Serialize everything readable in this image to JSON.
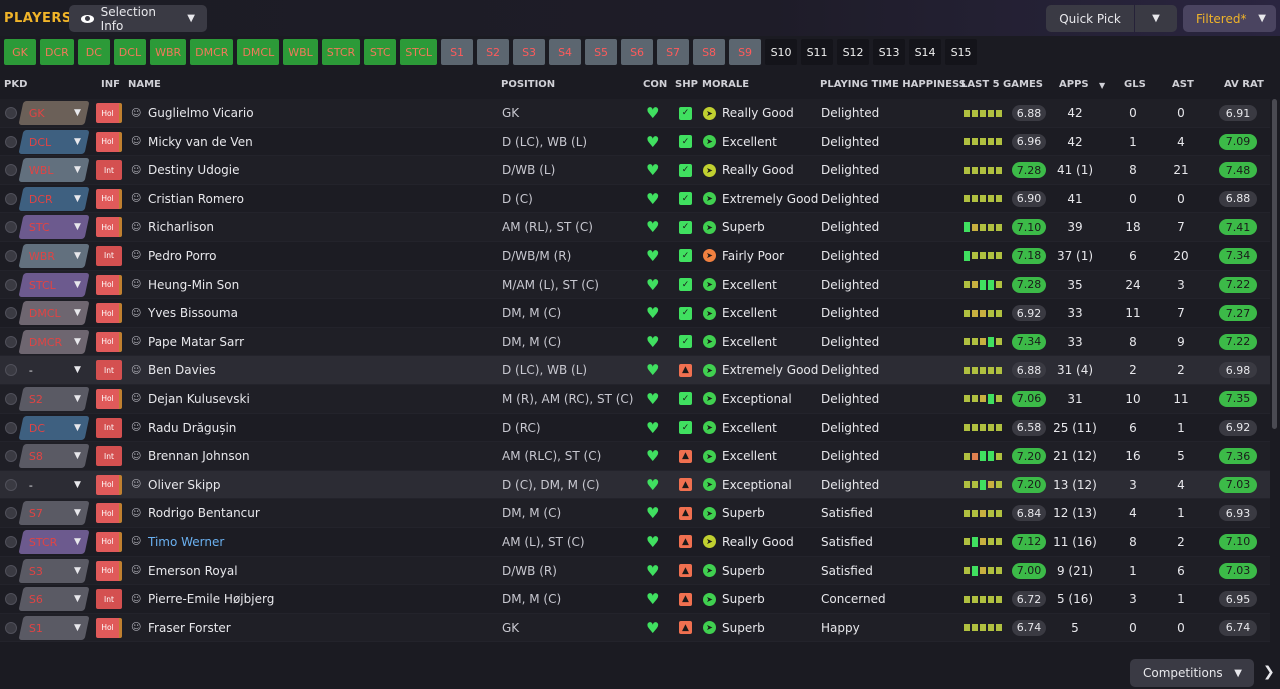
{
  "header": {
    "title": "PLAYERS",
    "selection_info": "Selection Info",
    "quick_pick": "Quick Pick",
    "filtered": "Filtered*"
  },
  "positions": [
    {
      "label": "GK",
      "state": "filled"
    },
    {
      "label": "DCR",
      "state": "filled"
    },
    {
      "label": "DC",
      "state": "filled"
    },
    {
      "label": "DCL",
      "state": "filled"
    },
    {
      "label": "WBR",
      "state": "filled"
    },
    {
      "label": "DMCR",
      "state": "filled"
    },
    {
      "label": "DMCL",
      "state": "filled"
    },
    {
      "label": "WBL",
      "state": "filled"
    },
    {
      "label": "STCR",
      "state": "filled"
    },
    {
      "label": "STC",
      "state": "filled"
    },
    {
      "label": "STCL",
      "state": "filled"
    },
    {
      "label": "S1",
      "state": "grey"
    },
    {
      "label": "S2",
      "state": "grey"
    },
    {
      "label": "S3",
      "state": "grey"
    },
    {
      "label": "S4",
      "state": "grey"
    },
    {
      "label": "S5",
      "state": "grey"
    },
    {
      "label": "S6",
      "state": "grey"
    },
    {
      "label": "S7",
      "state": "grey"
    },
    {
      "label": "S8",
      "state": "grey"
    },
    {
      "label": "S9",
      "state": "grey"
    },
    {
      "label": "S10",
      "state": "empty"
    },
    {
      "label": "S11",
      "state": "empty"
    },
    {
      "label": "S12",
      "state": "empty"
    },
    {
      "label": "S13",
      "state": "empty"
    },
    {
      "label": "S14",
      "state": "empty"
    },
    {
      "label": "S15",
      "state": "empty"
    }
  ],
  "columns": {
    "pkd": "PKD",
    "inf": "INF",
    "name": "NAME",
    "position": "POSITION",
    "con": "CON",
    "shp": "SHP",
    "morale": "MORALE",
    "pth": "PLAYING TIME HAPPINESS",
    "last5": "LAST 5 GAMES",
    "apps": "APPS",
    "gls": "GLS",
    "ast": "AST",
    "avrat": "AV RAT"
  },
  "players": [
    {
      "pkd": "GK",
      "pkd_style": "gk",
      "inf": "Hol",
      "name": "Guglielmo Vicario",
      "position": "GK",
      "shp": "g",
      "morale": "Really Good",
      "morale_color": "yellow",
      "pth": "Delighted",
      "bars": [
        "gr",
        "gr",
        "gr",
        "gr",
        "gr"
      ],
      "last5": "6.88",
      "last5_good": false,
      "apps": "42",
      "gls": "0",
      "ast": "0",
      "avrat": "6.91",
      "avrat_good": false
    },
    {
      "pkd": "DCL",
      "pkd_style": "def",
      "inf": "Hol",
      "name": "Micky van de Ven",
      "position": "D (LC), WB (L)",
      "shp": "g",
      "morale": "Excellent",
      "morale_color": "green",
      "pth": "Delighted",
      "bars": [
        "gr",
        "gr",
        "gr",
        "gr",
        "gr"
      ],
      "last5": "6.96",
      "last5_good": false,
      "apps": "42",
      "gls": "1",
      "ast": "4",
      "avrat": "7.09",
      "avrat_good": true
    },
    {
      "pkd": "WBL",
      "pkd_style": "wb",
      "inf": "Int",
      "name": "Destiny Udogie",
      "position": "D/WB (L)",
      "shp": "g",
      "morale": "Really Good",
      "morale_color": "yellow",
      "pth": "Delighted",
      "bars": [
        "gr",
        "gr",
        "gr",
        "gr",
        "gr"
      ],
      "last5": "7.28",
      "last5_good": true,
      "apps": "41 (1)",
      "gls": "8",
      "ast": "21",
      "avrat": "7.48",
      "avrat_good": true
    },
    {
      "pkd": "DCR",
      "pkd_style": "def",
      "inf": "Hol",
      "name": "Cristian Romero",
      "position": "D (C)",
      "shp": "g",
      "morale": "Extremely Good",
      "morale_color": "green",
      "pth": "Delighted",
      "bars": [
        "gr",
        "gr",
        "gr",
        "gr",
        "gr"
      ],
      "last5": "6.90",
      "last5_good": false,
      "apps": "41",
      "gls": "0",
      "ast": "0",
      "avrat": "6.88",
      "avrat_good": false
    },
    {
      "pkd": "STC",
      "pkd_style": "att",
      "inf": "Hol",
      "name": "Richarlison",
      "position": "AM (RL), ST (C)",
      "shp": "g",
      "morale": "Superb",
      "morale_color": "green",
      "pth": "Delighted",
      "bars": [
        "g",
        "y",
        "gr",
        "gr",
        "gr"
      ],
      "last5": "7.10",
      "last5_good": true,
      "apps": "39",
      "gls": "18",
      "ast": "7",
      "avrat": "7.41",
      "avrat_good": true
    },
    {
      "pkd": "WBR",
      "pkd_style": "wb",
      "inf": "Int",
      "name": "Pedro Porro",
      "position": "D/WB/M (R)",
      "shp": "g",
      "morale": "Fairly Poor",
      "morale_color": "orange",
      "pth": "Delighted",
      "bars": [
        "g",
        "gr",
        "gr",
        "gr",
        "gr"
      ],
      "last5": "7.18",
      "last5_good": true,
      "apps": "37 (1)",
      "gls": "6",
      "ast": "20",
      "avrat": "7.34",
      "avrat_good": true
    },
    {
      "pkd": "STCL",
      "pkd_style": "att",
      "inf": "Hol",
      "name": "Heung-Min Son",
      "position": "M/AM (L), ST (C)",
      "shp": "g",
      "morale": "Excellent",
      "morale_color": "green",
      "pth": "Delighted",
      "bars": [
        "gr",
        "y",
        "g",
        "g",
        "gr"
      ],
      "last5": "7.28",
      "last5_good": true,
      "apps": "35",
      "gls": "24",
      "ast": "3",
      "avrat": "7.22",
      "avrat_good": true
    },
    {
      "pkd": "DMCL",
      "pkd_style": "mid",
      "inf": "Hol",
      "name": "Yves Bissouma",
      "position": "DM, M (C)",
      "shp": "g",
      "morale": "Excellent",
      "morale_color": "green",
      "pth": "Delighted",
      "bars": [
        "gr",
        "y",
        "y",
        "gr",
        "gr"
      ],
      "last5": "6.92",
      "last5_good": false,
      "apps": "33",
      "gls": "11",
      "ast": "7",
      "avrat": "7.27",
      "avrat_good": true
    },
    {
      "pkd": "DMCR",
      "pkd_style": "mid",
      "inf": "Hol",
      "name": "Pape Matar Sarr",
      "position": "DM, M (C)",
      "shp": "g",
      "morale": "Excellent",
      "morale_color": "green",
      "pth": "Delighted",
      "bars": [
        "gr",
        "gr",
        "y",
        "g",
        "gr"
      ],
      "last5": "7.34",
      "last5_good": true,
      "apps": "33",
      "gls": "8",
      "ast": "9",
      "avrat": "7.22",
      "avrat_good": true
    },
    {
      "pkd": "-",
      "pkd_style": "none",
      "inf": "Int",
      "name": "Ben Davies",
      "position": "D (LC), WB (L)",
      "shp": "o",
      "morale": "Extremely Good",
      "morale_color": "green",
      "pth": "Delighted",
      "bars": [
        "gr",
        "gr",
        "gr",
        "gr",
        "gr"
      ],
      "last5": "6.88",
      "last5_good": false,
      "apps": "31 (4)",
      "gls": "2",
      "ast": "2",
      "avrat": "6.98",
      "avrat_good": false
    },
    {
      "pkd": "S2",
      "pkd_style": "sub",
      "inf": "Hol",
      "name": "Dejan Kulusevski",
      "position": "M (R), AM (RC), ST (C)",
      "shp": "g",
      "morale": "Exceptional",
      "morale_color": "green",
      "pth": "Delighted",
      "bars": [
        "gr",
        "gr",
        "y",
        "g",
        "gr"
      ],
      "last5": "7.06",
      "last5_good": true,
      "apps": "31",
      "gls": "10",
      "ast": "11",
      "avrat": "7.35",
      "avrat_good": true
    },
    {
      "pkd": "DC",
      "pkd_style": "def",
      "inf": "Int",
      "name": "Radu Drăgușin",
      "position": "D (RC)",
      "shp": "g",
      "morale": "Excellent",
      "morale_color": "green",
      "pth": "Delighted",
      "bars": [
        "gr",
        "gr",
        "gr",
        "gr",
        "gr"
      ],
      "last5": "6.58",
      "last5_good": false,
      "apps": "25 (11)",
      "gls": "6",
      "ast": "1",
      "avrat": "6.92",
      "avrat_good": false
    },
    {
      "pkd": "S8",
      "pkd_style": "sub",
      "inf": "Int",
      "name": "Brennan Johnson",
      "position": "AM (RLC), ST (C)",
      "shp": "o",
      "morale": "Excellent",
      "morale_color": "green",
      "pth": "Delighted",
      "bars": [
        "gr",
        "o",
        "g",
        "g",
        "gr"
      ],
      "last5": "7.20",
      "last5_good": true,
      "apps": "21 (12)",
      "gls": "16",
      "ast": "5",
      "avrat": "7.36",
      "avrat_good": true
    },
    {
      "pkd": "-",
      "pkd_style": "none",
      "inf": "Hol",
      "name": "Oliver Skipp",
      "position": "D (C), DM, M (C)",
      "shp": "o",
      "morale": "Exceptional",
      "morale_color": "green",
      "pth": "Delighted",
      "bars": [
        "gr",
        "gr",
        "g",
        "y",
        "gr"
      ],
      "last5": "7.20",
      "last5_good": true,
      "apps": "13 (12)",
      "gls": "3",
      "ast": "4",
      "avrat": "7.03",
      "avrat_good": true
    },
    {
      "pkd": "S7",
      "pkd_style": "sub",
      "inf": "Hol",
      "name": "Rodrigo Bentancur",
      "position": "DM, M (C)",
      "shp": "o",
      "morale": "Superb",
      "morale_color": "green",
      "pth": "Satisfied",
      "bars": [
        "gr",
        "gr",
        "y",
        "gr",
        "gr"
      ],
      "last5": "6.84",
      "last5_good": false,
      "apps": "12 (13)",
      "gls": "4",
      "ast": "1",
      "avrat": "6.93",
      "avrat_good": false
    },
    {
      "pkd": "STCR",
      "pkd_style": "att",
      "inf": "Hol",
      "name": "Timo Werner",
      "position": "AM (L), ST (C)",
      "shp": "o",
      "morale": "Really Good",
      "morale_color": "yellow",
      "pth": "Satisfied",
      "bars": [
        "gr",
        "g",
        "y",
        "gr",
        "gr"
      ],
      "last5": "7.12",
      "last5_good": true,
      "apps": "11 (16)",
      "gls": "8",
      "ast": "2",
      "avrat": "7.10",
      "avrat_good": true,
      "link": true
    },
    {
      "pkd": "S3",
      "pkd_style": "sub",
      "inf": "Hol",
      "name": "Emerson Royal",
      "position": "D/WB (R)",
      "shp": "o",
      "morale": "Superb",
      "morale_color": "green",
      "pth": "Satisfied",
      "bars": [
        "gr",
        "g",
        "y",
        "gr",
        "gr"
      ],
      "last5": "7.00",
      "last5_good": true,
      "apps": "9 (21)",
      "gls": "1",
      "ast": "6",
      "avrat": "7.03",
      "avrat_good": true
    },
    {
      "pkd": "S6",
      "pkd_style": "sub",
      "inf": "Int",
      "name": "Pierre-Emile Højbjerg",
      "position": "DM, M (C)",
      "shp": "o",
      "morale": "Superb",
      "morale_color": "green",
      "pth": "Concerned",
      "bars": [
        "gr",
        "gr",
        "gr",
        "gr",
        "gr"
      ],
      "last5": "6.72",
      "last5_good": false,
      "apps": "5 (16)",
      "gls": "3",
      "ast": "1",
      "avrat": "6.95",
      "avrat_good": false
    },
    {
      "pkd": "S1",
      "pkd_style": "sub",
      "inf": "Hol",
      "name": "Fraser Forster",
      "position": "GK",
      "shp": "o",
      "morale": "Superb",
      "morale_color": "green",
      "pth": "Happy",
      "bars": [
        "gr",
        "gr",
        "gr",
        "gr",
        "gr"
      ],
      "last5": "6.74",
      "last5_good": false,
      "apps": "5",
      "gls": "0",
      "ast": "0",
      "avrat": "6.74",
      "avrat_good": false
    }
  ],
  "footer": {
    "competitions": "Competitions"
  }
}
